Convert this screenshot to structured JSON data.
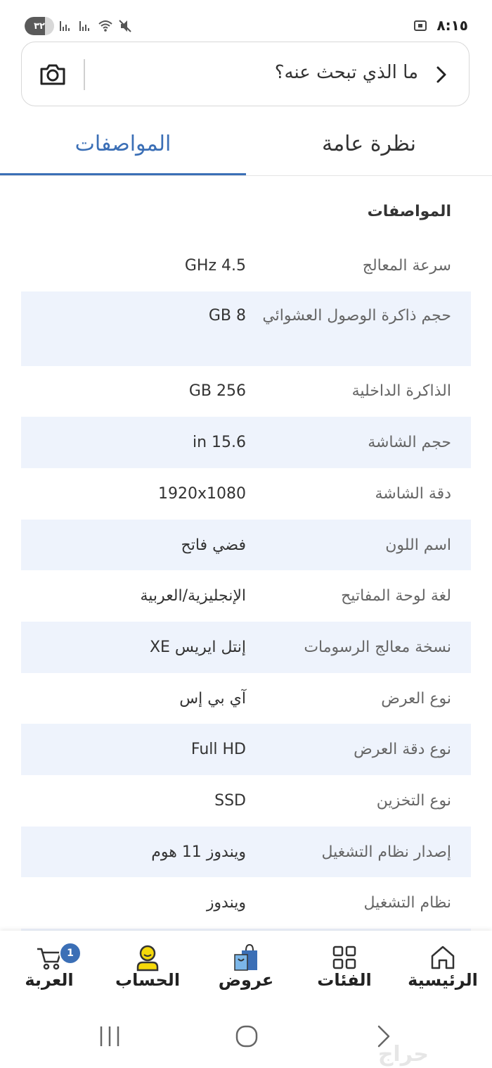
{
  "status_bar": {
    "battery": "٣٢",
    "time": "٨:١٥"
  },
  "search": {
    "placeholder": "ما الذي تبحث عنه؟"
  },
  "tabs": [
    {
      "label": "المواصفات",
      "active": true
    },
    {
      "label": "نظرة عامة",
      "active": false
    }
  ],
  "specs": {
    "title": "المواصفات",
    "rows": [
      {
        "label": "سرعة المعالج",
        "value": "4.5 GHz"
      },
      {
        "label": "حجم ذاكرة الوصول العشوائي",
        "value": "8 GB"
      },
      {
        "label": "الذاكرة الداخلية",
        "value": "256 GB"
      },
      {
        "label": "حجم الشاشة",
        "value": "15.6 in"
      },
      {
        "label": "دقة الشاشة",
        "value": "1920x1080"
      },
      {
        "label": "اسم اللون",
        "value": "فضي فاتح"
      },
      {
        "label": "لغة لوحة المفاتيح",
        "value": "الإنجليزية/العربية"
      },
      {
        "label": "نسخة معالج الرسومات",
        "value": "إنتل ايريس XE"
      },
      {
        "label": "نوع العرض",
        "value": "آي بي إس"
      },
      {
        "label": "نوع دقة العرض",
        "value": "Full HD"
      },
      {
        "label": "نوع التخزين",
        "value": "SSD"
      },
      {
        "label": "إصدار نظام التشغيل",
        "value": "ويندوز 11 هوم"
      },
      {
        "label": "نظام التشغيل",
        "value": "ويندوز"
      }
    ]
  },
  "bottom_nav": {
    "cart": {
      "label": "العربة",
      "badge": "1",
      "icon": "cart-icon"
    },
    "account": {
      "label": "الحساب",
      "icon": "user-icon"
    },
    "offers": {
      "label": "عروض",
      "icon": "shopping-bag-icon"
    },
    "categories": {
      "label": "الفئات",
      "icon": "grid-icon"
    },
    "home": {
      "label": "الرئيسية",
      "icon": "home-icon"
    }
  },
  "watermark": "حراج",
  "colors": {
    "accent": "#3b6fb6",
    "row_shade": "#eef3fc",
    "account_icon": "#f5d90a"
  }
}
